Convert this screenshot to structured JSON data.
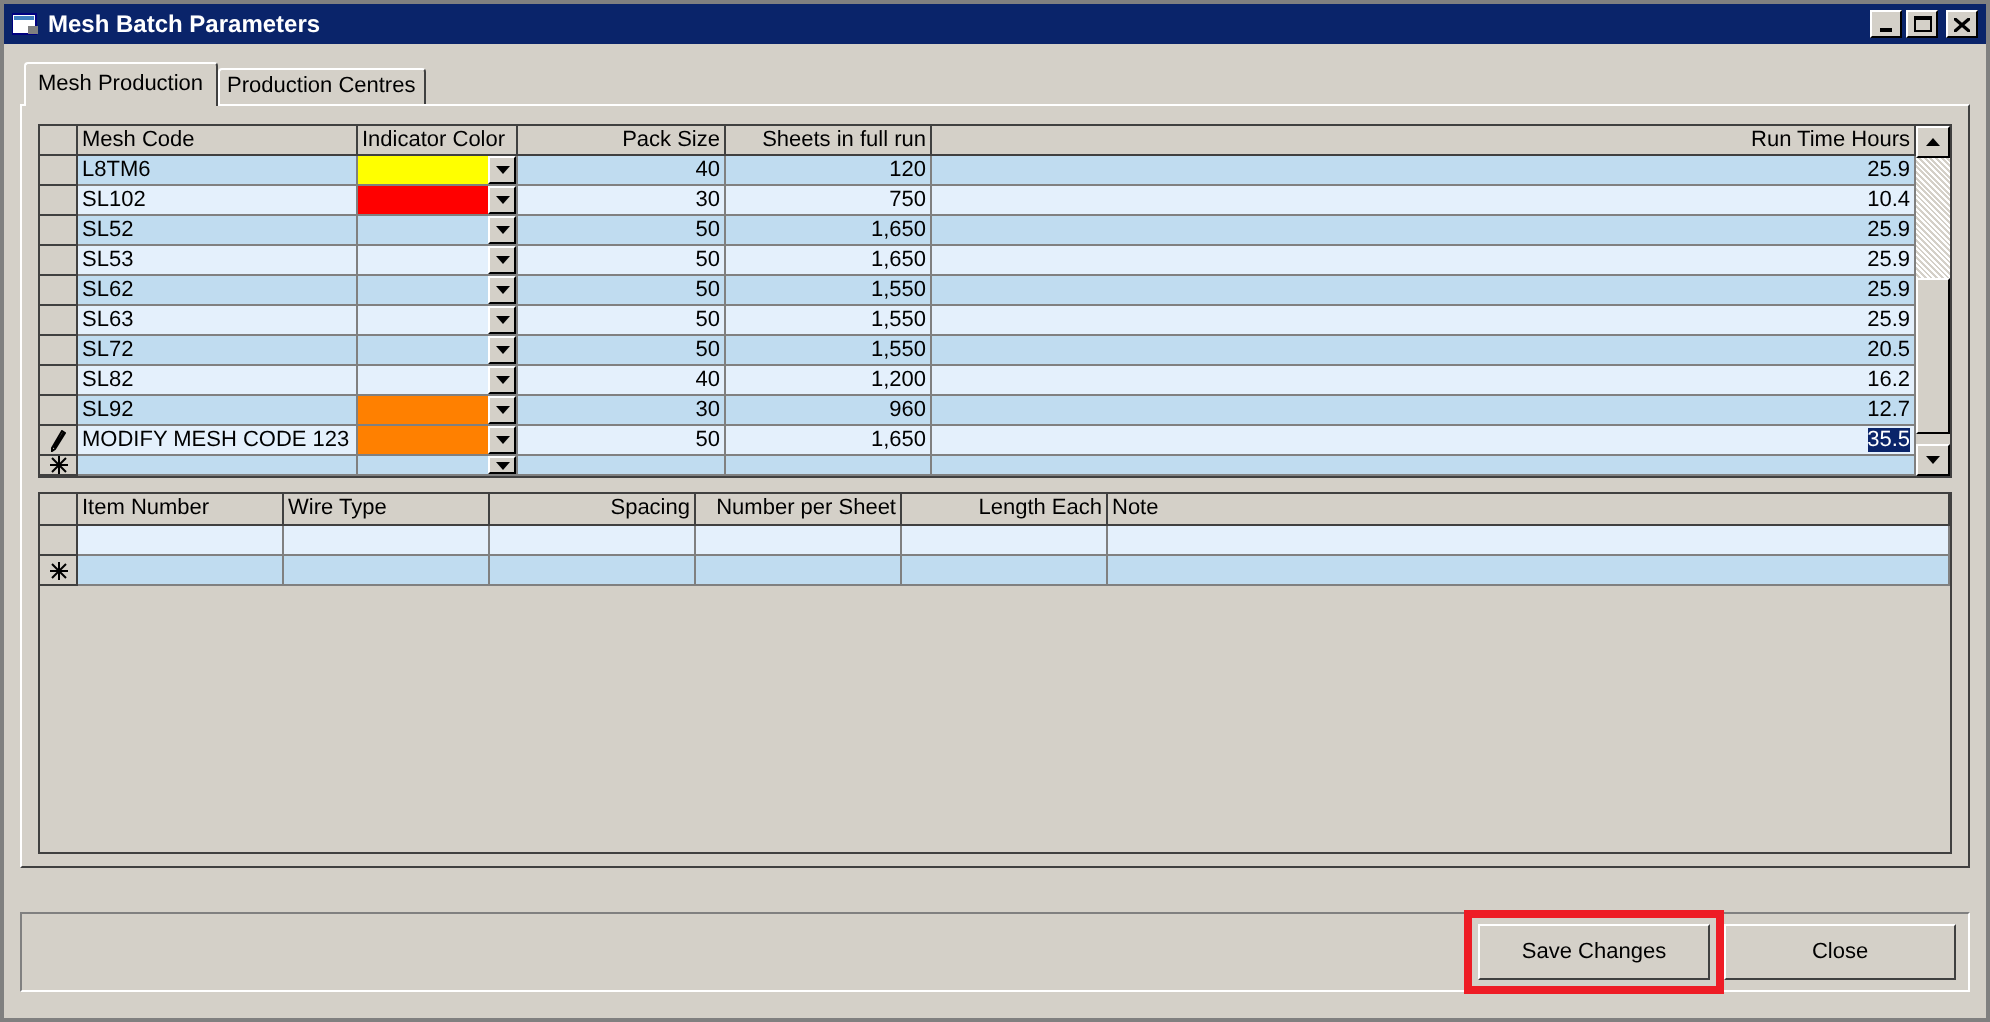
{
  "window": {
    "title": "Mesh Batch Parameters"
  },
  "tabs": [
    {
      "label": "Mesh Production",
      "selected": true
    },
    {
      "label": "Production Centres",
      "selected": false
    }
  ],
  "batches": {
    "columns": [
      "Mesh Code",
      "Indicator Color",
      "Pack Size",
      "Sheets in full run",
      "Run Time Hours"
    ],
    "rows": [
      {
        "code": "L8TM6",
        "color": "#ffff00",
        "pack": "40",
        "sheets": "120",
        "hours": "25.9",
        "editing": false,
        "hours_selected": false
      },
      {
        "code": "SL102",
        "color": "#ff0000",
        "pack": "30",
        "sheets": "750",
        "hours": "10.4",
        "editing": false,
        "hours_selected": false
      },
      {
        "code": "SL52",
        "pack": "50",
        "sheets": "1,650",
        "hours": "25.9",
        "editing": false,
        "hours_selected": false
      },
      {
        "code": "SL53",
        "pack": "50",
        "sheets": "1,650",
        "hours": "25.9",
        "editing": false,
        "hours_selected": false
      },
      {
        "code": "SL62",
        "pack": "50",
        "sheets": "1,550",
        "hours": "25.9",
        "editing": false,
        "hours_selected": false
      },
      {
        "code": "SL63",
        "pack": "50",
        "sheets": "1,550",
        "hours": "25.9",
        "editing": false,
        "hours_selected": false
      },
      {
        "code": "SL72",
        "pack": "50",
        "sheets": "1,550",
        "hours": "20.5",
        "editing": false,
        "hours_selected": false
      },
      {
        "code": "SL82",
        "pack": "40",
        "sheets": "1,200",
        "hours": "16.2",
        "editing": false,
        "hours_selected": false
      },
      {
        "code": "SL92",
        "color": "#ff8000",
        "pack": "30",
        "sheets": "960",
        "hours": "12.7",
        "editing": false,
        "hours_selected": false
      },
      {
        "code": "MODIFY MESH CODE 123",
        "color": "#ff8000",
        "pack": "50",
        "sheets": "1,650",
        "hours": "35.5",
        "editing": true,
        "hours_selected": true
      }
    ]
  },
  "items": {
    "columns": [
      "Item Number",
      "Wire Type",
      "Spacing",
      "Number per Sheet",
      "Length Each",
      "Note"
    ],
    "rows": [
      {
        "new_row": false
      },
      {
        "new_row": true
      }
    ]
  },
  "buttons": [
    {
      "label": "Save Changes",
      "highlighted": true
    },
    {
      "label": "Close",
      "highlighted": false
    }
  ]
}
